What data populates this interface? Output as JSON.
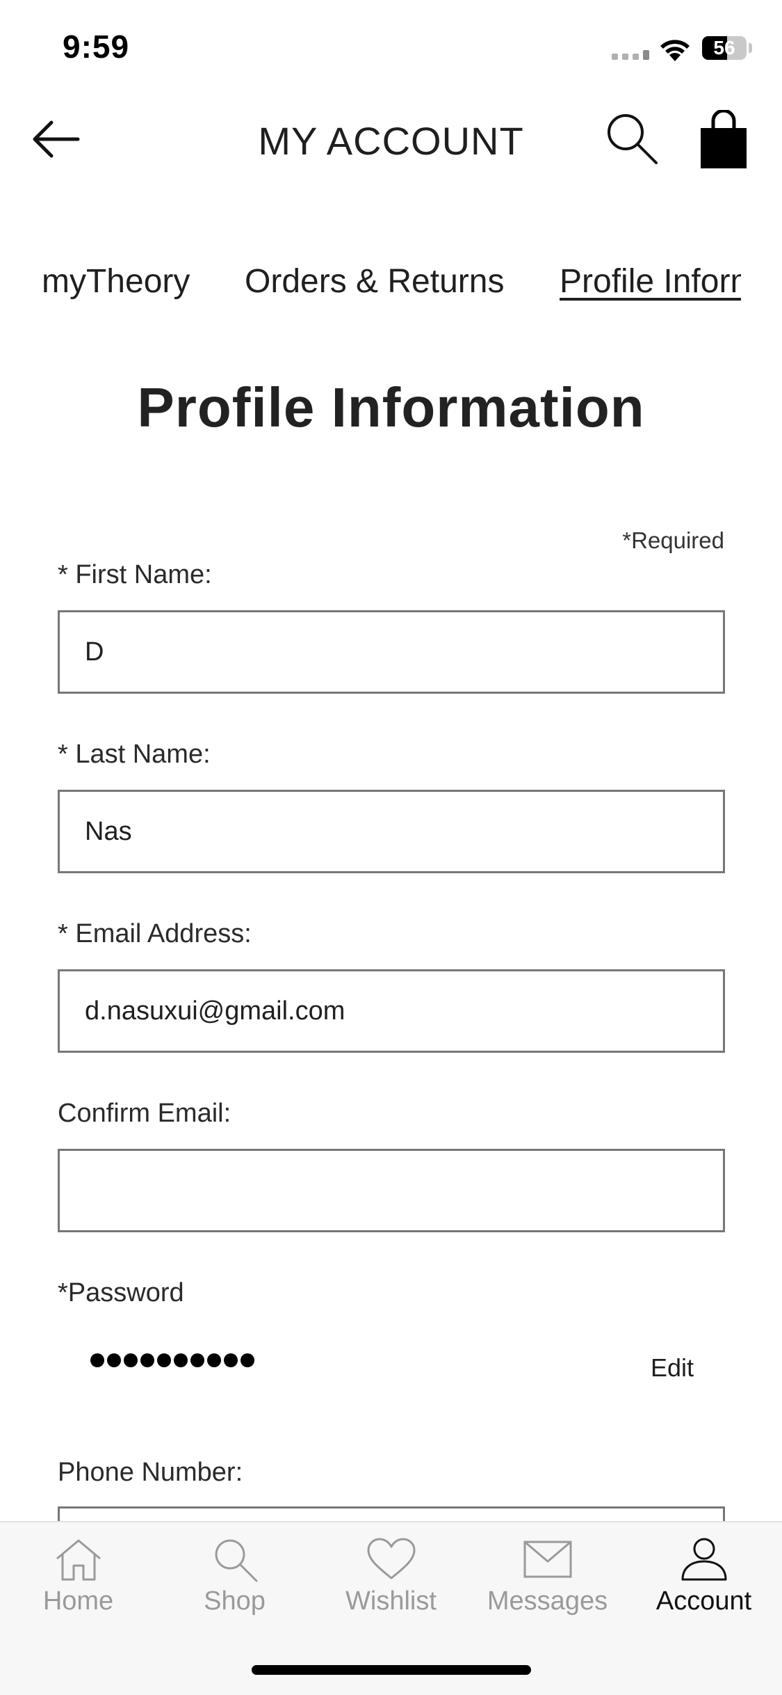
{
  "status_bar": {
    "time": "9:59",
    "battery": "56"
  },
  "header": {
    "title": "MY ACCOUNT"
  },
  "tabs": [
    {
      "label": "myTheory"
    },
    {
      "label": "Orders & Returns"
    },
    {
      "label": "Profile Information",
      "active": true
    }
  ],
  "page": {
    "title": "Profile Information",
    "required_note": "*Required"
  },
  "form": {
    "first_name": {
      "label": "* First Name:",
      "value": "D"
    },
    "last_name": {
      "label": "* Last Name:",
      "value": "Nas"
    },
    "email": {
      "label": "* Email Address:",
      "value": "d.nasuxui@gmail.com"
    },
    "confirm_email": {
      "label": "Confirm Email:",
      "value": ""
    },
    "password": {
      "label": "*Password",
      "masked": "●●●●●●●●●●",
      "edit_label": "Edit"
    },
    "phone": {
      "label": "Phone Number:",
      "value": ""
    }
  },
  "bottom_nav": [
    {
      "label": "Home",
      "icon": "home-icon"
    },
    {
      "label": "Shop",
      "icon": "search-icon"
    },
    {
      "label": "Wishlist",
      "icon": "heart-icon"
    },
    {
      "label": "Messages",
      "icon": "envelope-icon"
    },
    {
      "label": "Account",
      "icon": "person-icon",
      "active": true
    }
  ],
  "colors": {
    "text": "#1f1f1f",
    "nav_inactive": "#9a9a9a",
    "nav_bg": "#f7f7f7",
    "input_border": "#777777"
  }
}
